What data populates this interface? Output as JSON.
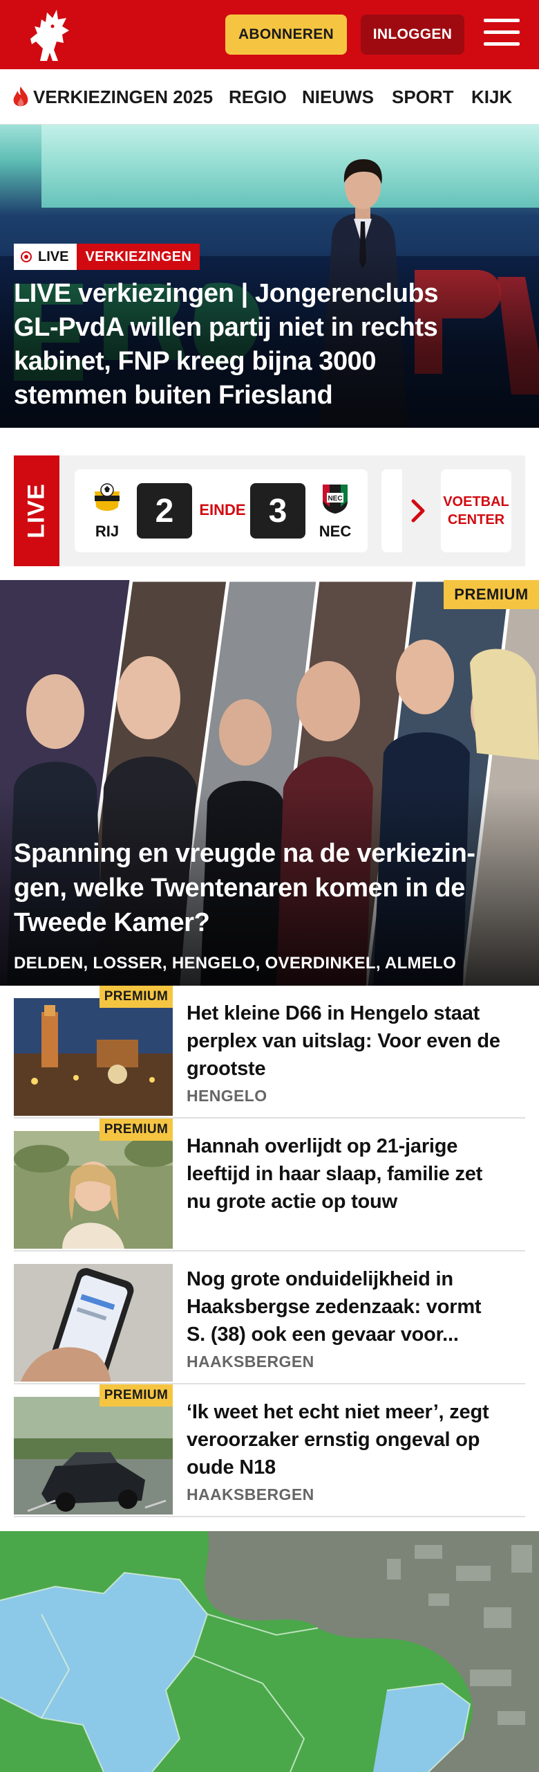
{
  "header": {
    "logo_icon": "horse-icon",
    "subscribe_label": "ABONNEREN",
    "login_label": "INLOGGEN",
    "menu_icon": "hamburger-icon",
    "brand_color": "#d10a11",
    "accent_color": "#f5c542"
  },
  "nav": {
    "items": [
      {
        "label": "VERKIEZINGEN 2025",
        "icon": "flame-icon"
      },
      {
        "label": "REGIO"
      },
      {
        "label": "NIEUWS"
      },
      {
        "label": "SPORT"
      },
      {
        "label": "KIJK"
      }
    ]
  },
  "hero": {
    "live_badge": "LIVE",
    "category": "VERKIEZINGEN",
    "title_lines": [
      "LIVE verkiezingen | Jongerenclubs",
      "GL-PvdA willen partij niet in rechts",
      "kabinet, FNP kreeg bijna 3000",
      "stemmen buiten Friesland"
    ]
  },
  "scores": {
    "live_label": "LIVE",
    "home_team": "RIJ",
    "home_score": "2",
    "status": "EINDE",
    "away_score": "3",
    "away_team": "NEC",
    "center_label_lines": [
      "VOETBAL",
      "CENTER"
    ]
  },
  "feature": {
    "premium": "PREMIUM",
    "title_lines": [
      "Spanning en vreugde na de verkiezin-",
      "gen, welke Twentenaren komen in de",
      "Tweede Kamer?"
    ],
    "places": "DELDEN, LOSSER, HENGELO, OVERDINKEL, ALMELO"
  },
  "articles": [
    {
      "premium": "PREMIUM",
      "title_lines": [
        "Het kleine D66 in Hengelo staat",
        "perplex van uitslag: Voor even de",
        "grootste"
      ],
      "place": "HENGELO"
    },
    {
      "premium": "PREMIUM",
      "title_lines": [
        "Hannah overlijdt op 21-jarige",
        "leeftijd in haar slaap, familie zet",
        "nu grote actie op touw"
      ],
      "place": ""
    },
    {
      "premium": "",
      "title_lines": [
        "Nog grote onduidelijkheid in",
        "Haaksbergse zedenzaak: vormt",
        "S. (38) ook een gevaar voor..."
      ],
      "place": "HAAKSBERGEN"
    },
    {
      "premium": "PREMIUM",
      "title_lines": [
        "‘Ik weet het echt niet meer’, zegt",
        "veroorzaker ernstig ongeval op",
        "oude N18"
      ],
      "place": "HAAKSBERGEN"
    }
  ]
}
